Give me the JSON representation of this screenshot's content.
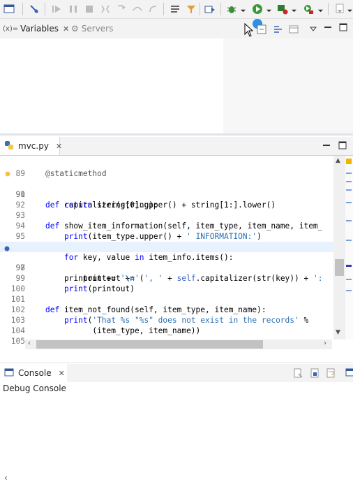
{
  "toolbar": {
    "icons": [
      "toggle-console-icon",
      "skip-breakpoints-icon",
      "resume-icon",
      "suspend-icon",
      "terminate-icon",
      "disconnect-icon",
      "step-into-icon",
      "step-over-icon",
      "step-return-icon",
      "drop-to-frame-icon",
      "use-step-filters-icon",
      "open-console-icon",
      "debug-icon",
      "run-icon",
      "coverage-icon",
      "external-tools-icon",
      "next-annotation-icon"
    ]
  },
  "views_top": {
    "variables_tab": "Variables",
    "variables_prefix": "(x)=",
    "servers_tab": "Servers"
  },
  "editor": {
    "tab_label": "mvc.py",
    "lines": [
      {
        "n": "89",
        "t": "@staticmethod"
      },
      {
        "n": "90",
        "t": "def capitalizer(string):"
      },
      {
        "n": "91",
        "t": "    return string[0].upper() + string[1:].lower()"
      },
      {
        "n": "92",
        "t": ""
      },
      {
        "n": "93",
        "t": "def show_item_information(self, item_type, item_name, item_"
      },
      {
        "n": "94",
        "t": "    print(item_type.upper() + ' INFORMATION:')"
      },
      {
        "n": "95",
        "t": "    printout = 'Name: %s' % item_name"
      },
      {
        "n": "96",
        "t": "    for key, value in item_info.items():"
      },
      {
        "n": "97",
        "t": "        printout += (', ' + self.capitalizer(str(key)) + ':"
      },
      {
        "n": "98",
        "t": "    printout += '\\n'"
      },
      {
        "n": "99",
        "t": "    print(printout)"
      },
      {
        "n": "100",
        "t": ""
      },
      {
        "n": "101",
        "t": "def item_not_found(self, item_type, item_name):"
      },
      {
        "n": "102",
        "t": "    print('That %s \"%s\" does not exist in the records' %"
      },
      {
        "n": "103",
        "t": "          (item_type, item_name))"
      },
      {
        "n": "104",
        "t": ""
      },
      {
        "n": "105",
        "t": ""
      }
    ]
  },
  "console": {
    "tab_label": "Console",
    "subtitle": "Debug Console"
  },
  "colors": {
    "keyword": "#0000ff",
    "string": "#00aa00",
    "current_line": "#e8f2fe",
    "toolbar_bg": "#f3f3f3"
  }
}
